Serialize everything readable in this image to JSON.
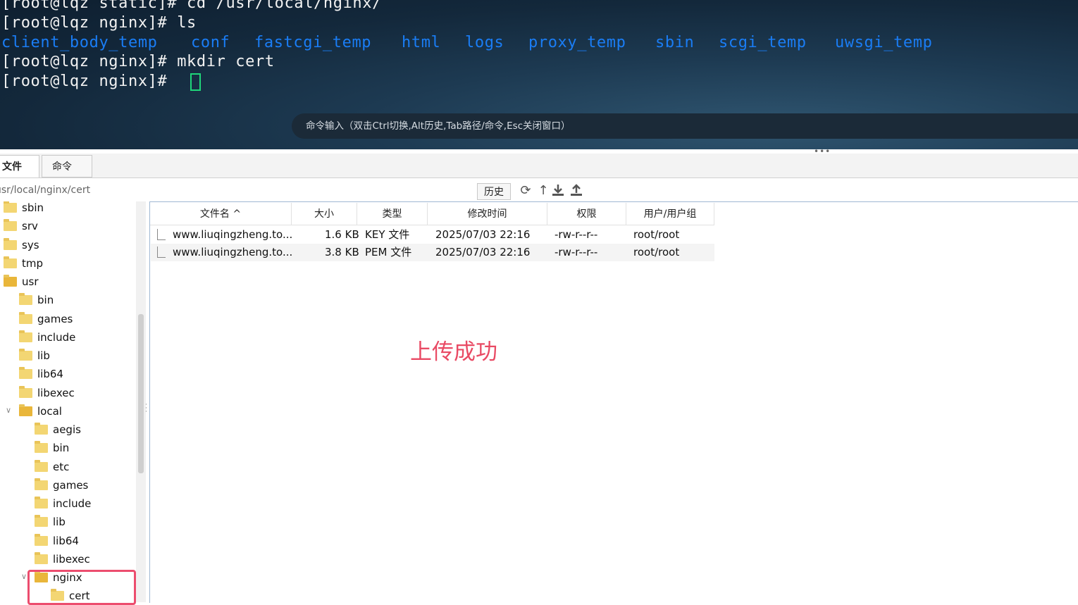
{
  "terminal": {
    "line1": "[root@lqz static]# cd /usr/local/nginx/",
    "line2": "[root@lqz nginx]# ls",
    "dirs": [
      "client_body_temp",
      "conf",
      "fastcgi_temp",
      "html",
      "logs",
      "proxy_temp",
      "sbin",
      "scgi_temp",
      "uwsgi_temp"
    ],
    "line4": "[root@lqz nginx]# mkdir cert",
    "line5": "[root@lqz nginx]# ",
    "command_bar": "命令输入（双击Ctrl切换,Alt历史,Tab路径/命令,Esc关闭窗口）",
    "splitter_dots": "•••"
  },
  "tabs": {
    "files": "文件",
    "commands": "命令"
  },
  "path": {
    "value": "usr/local/nginx/cert",
    "history_button": "历史"
  },
  "toolbar_icons": [
    "refresh-icon",
    "up-icon",
    "download-icon",
    "upload-icon"
  ],
  "tree": [
    {
      "label": "sbin"
    },
    {
      "label": "srv"
    },
    {
      "label": "sys"
    },
    {
      "label": "tmp"
    },
    {
      "label": "usr"
    },
    {
      "label": "bin"
    },
    {
      "label": "games"
    },
    {
      "label": "include"
    },
    {
      "label": "lib"
    },
    {
      "label": "lib64"
    },
    {
      "label": "libexec"
    },
    {
      "label": "local"
    },
    {
      "label": "aegis"
    },
    {
      "label": "bin"
    },
    {
      "label": "etc"
    },
    {
      "label": "games"
    },
    {
      "label": "include"
    },
    {
      "label": "lib"
    },
    {
      "label": "lib64"
    },
    {
      "label": "libexec"
    },
    {
      "label": "nginx"
    },
    {
      "label": "cert"
    }
  ],
  "columns": {
    "name": "文件名 ^",
    "size": "大小",
    "type": "类型",
    "mtime": "修改时间",
    "perm": "权限",
    "owner": "用户/用户组"
  },
  "files": [
    {
      "name": "www.liuqingzheng.to...",
      "size": "1.6 KB",
      "type": "KEY 文件",
      "mtime": "2025/07/03 22:16",
      "perm": "-rw-r--r--",
      "owner": "root/root"
    },
    {
      "name": "www.liuqingzheng.to...",
      "size": "3.8 KB",
      "type": "PEM 文件",
      "mtime": "2025/07/03 22:16",
      "perm": "-rw-r--r--",
      "owner": "root/root"
    }
  ],
  "annotation": "上传成功",
  "colors": {
    "dir_blue": "#1e88ff",
    "cursor_green": "#1fd67a",
    "annotation_red": "#e94a64"
  }
}
